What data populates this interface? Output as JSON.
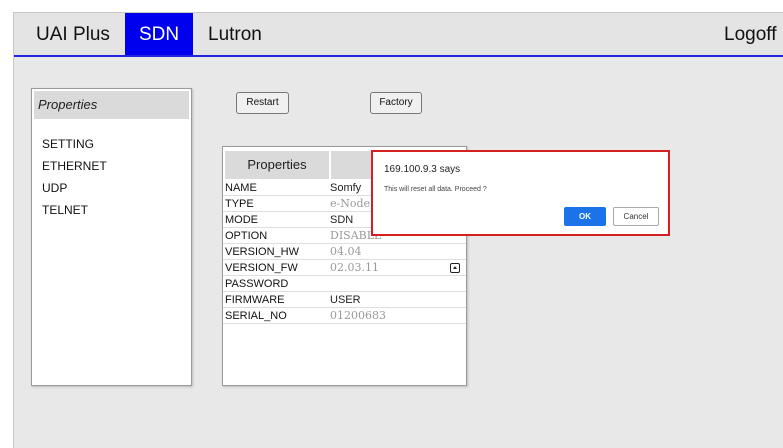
{
  "nav": {
    "items": [
      "UAI Plus",
      "SDN",
      "Lutron"
    ],
    "active": "SDN",
    "logoff": "Logoff",
    "accent_color": "#0000ee"
  },
  "sidebar": {
    "header": "Properties",
    "items": [
      "SETTING",
      "ETHERNET",
      "UDP",
      "TELNET"
    ]
  },
  "toolbar": {
    "restart_label": "Restart",
    "factory_label": "Factory"
  },
  "properties_table": {
    "col1": "Properties",
    "col2": "S",
    "rows": [
      {
        "key": "NAME",
        "value": "Somfy"
      },
      {
        "key": "TYPE",
        "value": "e-Node 2"
      },
      {
        "key": "MODE",
        "value": "SDN"
      },
      {
        "key": "OPTION",
        "value": "DISABLE"
      },
      {
        "key": "VERSION_HW",
        "value": "04.04"
      },
      {
        "key": "VERSION_FW",
        "value": "02.03.11",
        "icon": "upload-icon"
      },
      {
        "key": "PASSWORD",
        "value": ""
      },
      {
        "key": "FIRMWARE",
        "value": "USER"
      },
      {
        "key": "SERIAL_NO",
        "value": "01200683"
      }
    ]
  },
  "dialog": {
    "title": "169.100.9.3 says",
    "message": "This will reset all data. Proceed ?",
    "ok_label": "OK",
    "cancel_label": "Cancel",
    "ok_color": "#1a73e8",
    "highlight_color": "#d42020"
  }
}
